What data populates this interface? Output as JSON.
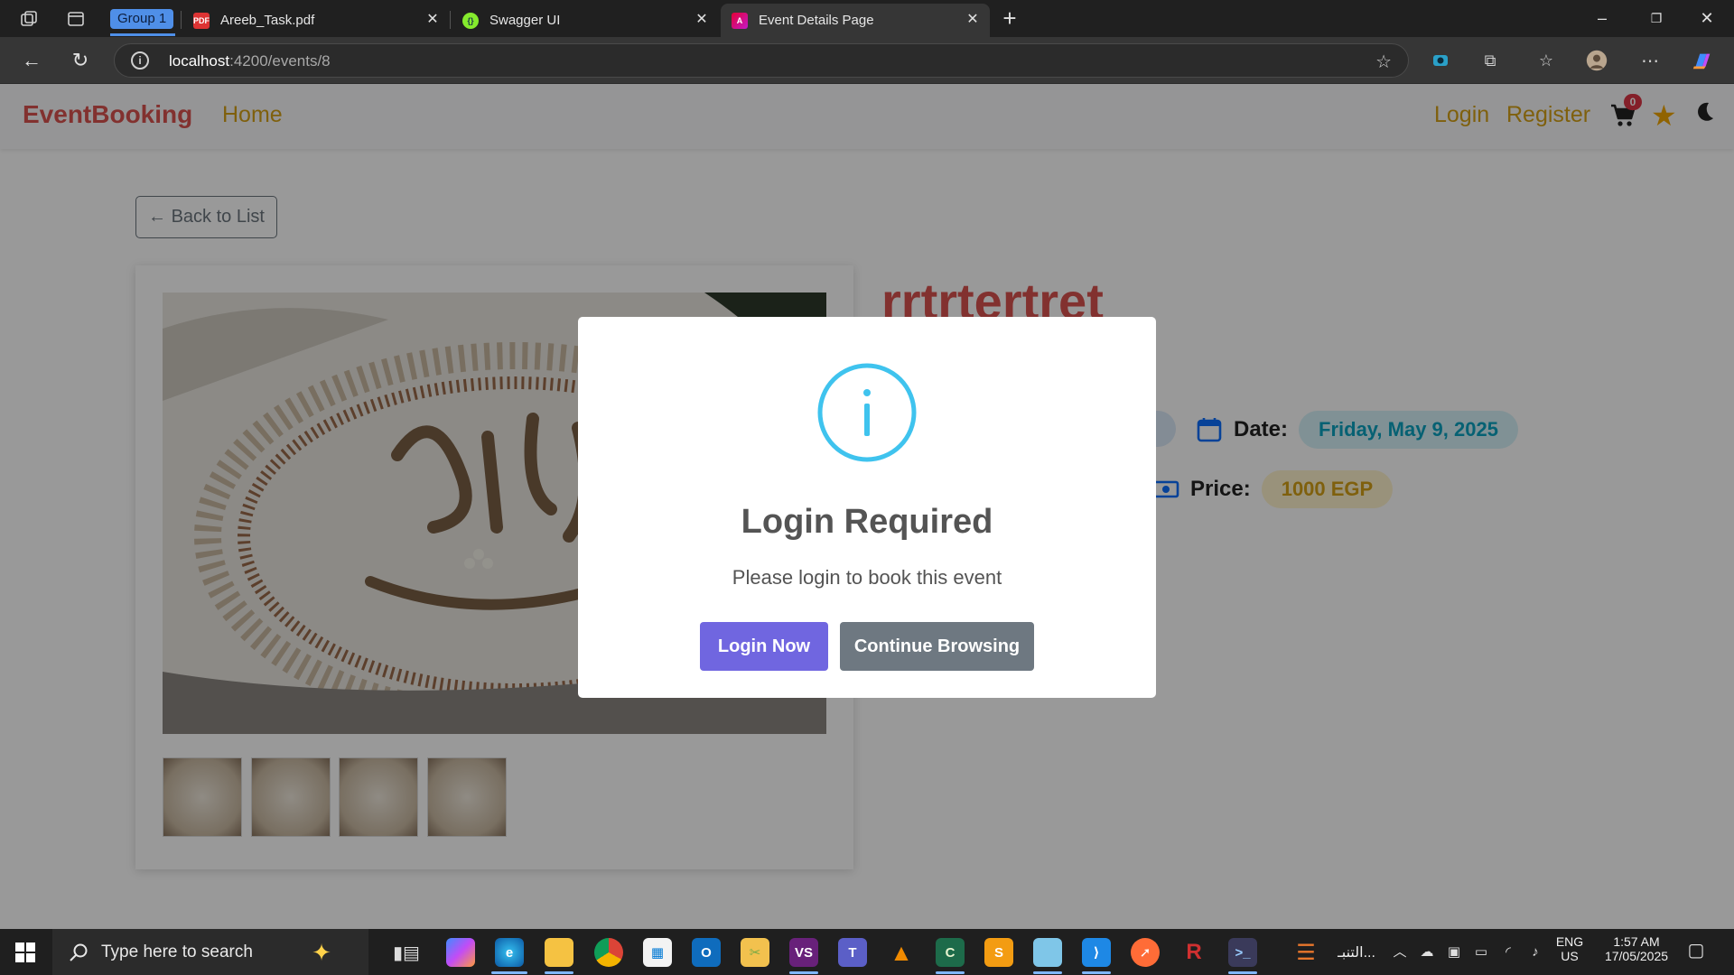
{
  "browser": {
    "tab_group_label": "Group 1",
    "tabs": [
      {
        "title": "Areeb_Task.pdf",
        "icon": "pdf-icon"
      },
      {
        "title": "Swagger UI",
        "icon": "swagger-icon"
      },
      {
        "title": "Event Details Page",
        "icon": "angular-icon",
        "active": true
      }
    ],
    "new_tab_label": "+",
    "url_host": "localhost",
    "url_rest": ":4200/events/8"
  },
  "app": {
    "brand": "EventBooking",
    "nav_home": "Home",
    "nav_login": "Login",
    "nav_register": "Register",
    "cart_count": "0",
    "back_label": "← Back to List",
    "event_title": "rrtrtertret",
    "date_label": "Date:",
    "date_value": "Friday, May 9, 2025",
    "price_label": "Price:",
    "price_value": "1000 EGP",
    "accent_color": "#d9534f",
    "link_color": "#d4a017"
  },
  "modal": {
    "icon": "info-icon",
    "title": "Login Required",
    "text": "Please login to book this event",
    "primary_button": "Login Now",
    "secondary_button": "Continue Browsing",
    "primary_color": "#7066e0",
    "secondary_color": "#6e7881"
  },
  "taskbar": {
    "search_placeholder": "Type here to search",
    "tray_app_label": "التنبـ...",
    "lang_top": "ENG",
    "lang_bottom": "US",
    "time": "1:57 AM",
    "date": "17/05/2025"
  }
}
